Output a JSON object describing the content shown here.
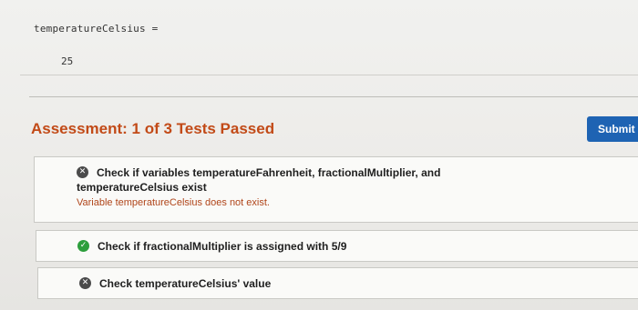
{
  "output": {
    "var_name": "temperatureCelsius =",
    "var_value": "25"
  },
  "assessment": {
    "title": "Assessment: 1 of 3 Tests Passed",
    "submit_label": "Submit"
  },
  "tests": [
    {
      "status": "fail",
      "title_line1": "Check if variables temperatureFahrenheit, fractionalMultiplier, and",
      "title_line2": "temperatureCelsius exist",
      "message": "Variable temperatureCelsius does not exist."
    },
    {
      "status": "pass",
      "title": "Check if fractionalMultiplier is assigned with 5/9"
    },
    {
      "status": "fail",
      "title": "Check temperatureCelsius' value"
    }
  ],
  "icons": {
    "fail_icon": "x-circle-icon",
    "pass_icon": "check-circle-icon"
  },
  "colors": {
    "assessment_title": "#c24a17",
    "submit_button": "#1e63b3",
    "pass": "#2d9e3c",
    "fail": "#4b4b4b",
    "error_message": "#b0451a"
  }
}
